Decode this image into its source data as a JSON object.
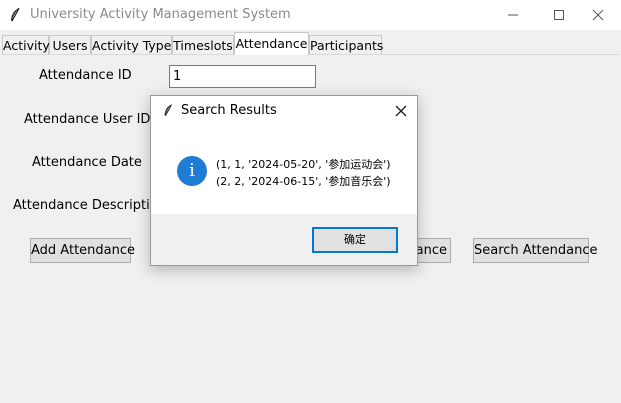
{
  "window": {
    "title": "University Activity Management System"
  },
  "tabs": [
    {
      "label": "Activity"
    },
    {
      "label": "Users"
    },
    {
      "label": "Activity Type"
    },
    {
      "label": "Timeslots"
    },
    {
      "label": "Attendance"
    },
    {
      "label": "Participants"
    }
  ],
  "form": {
    "attendance_id_label": "Attendance ID",
    "attendance_id_value": "1",
    "user_id_label": "Attendance User ID",
    "date_label": "Attendance Date",
    "description_label": "Attendance Description"
  },
  "buttons": {
    "add": "Add Attendance",
    "update_partial": "dance",
    "search": "Search Attendance"
  },
  "dialog": {
    "title": "Search Results",
    "lines": [
      "(1, 1, '2024-05-20', '参加运动会')",
      "(2, 2, '2024-06-15', '参加音乐会')"
    ],
    "ok_label": "确定"
  }
}
